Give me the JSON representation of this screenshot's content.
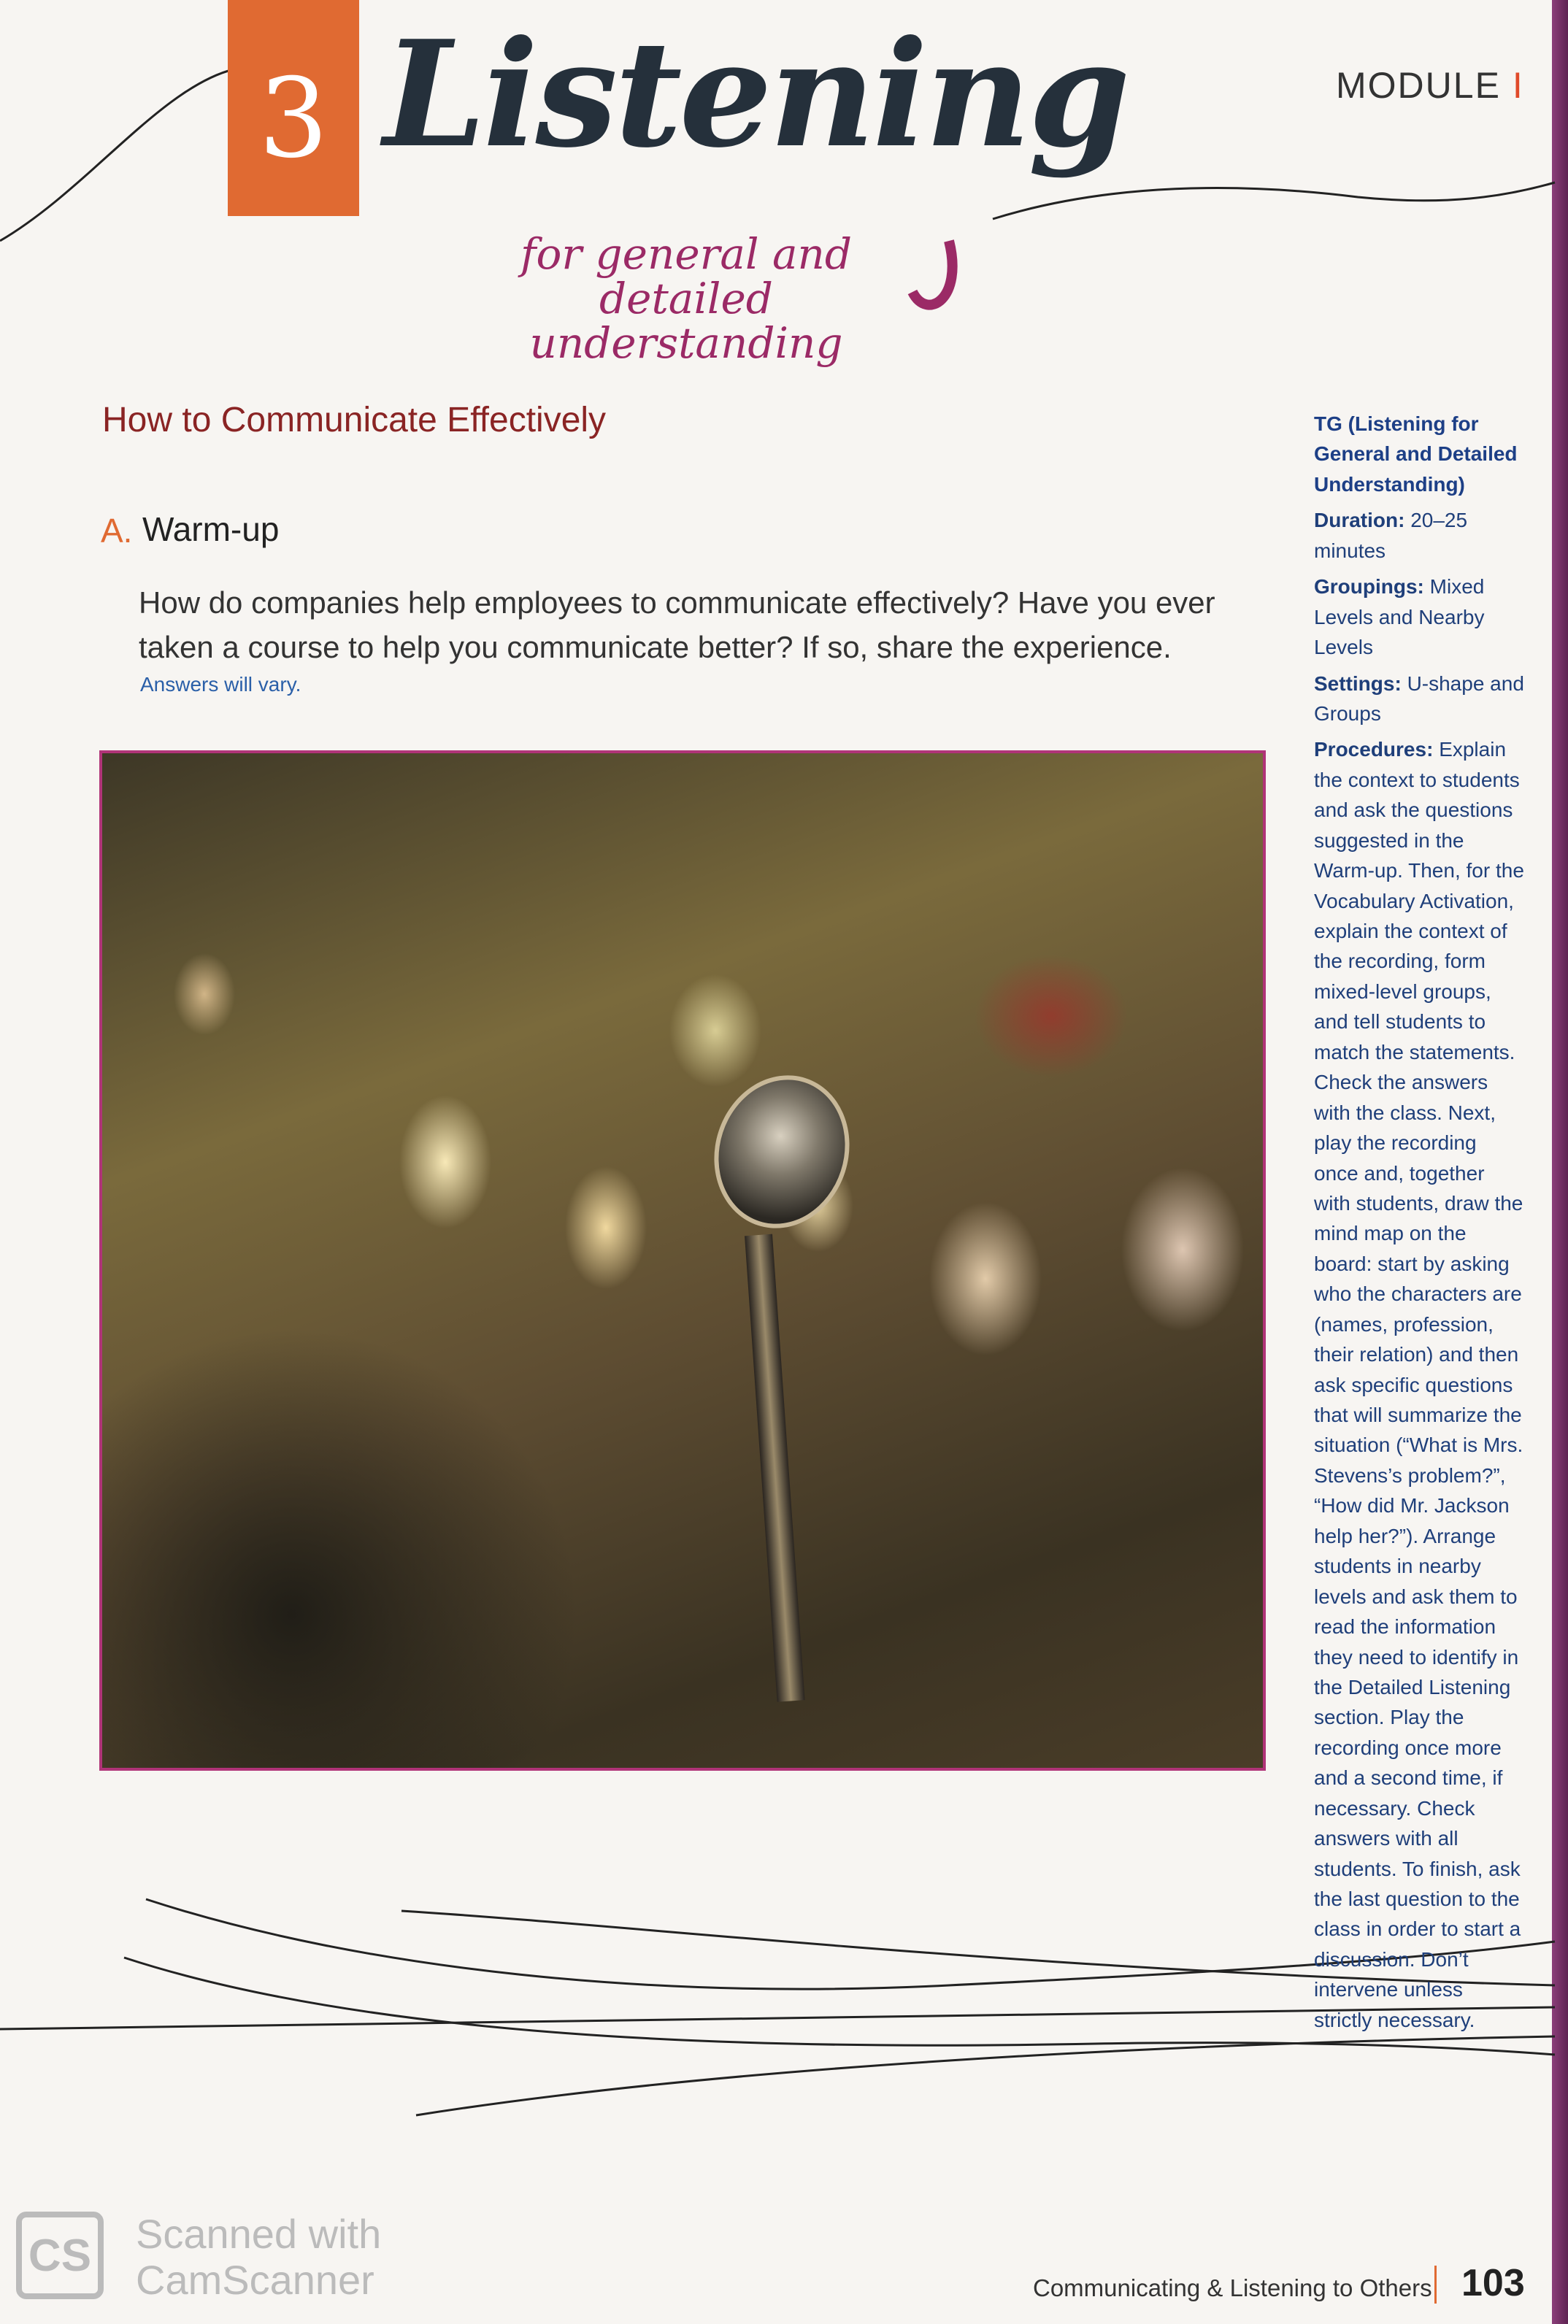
{
  "header": {
    "chapter_number": "3",
    "title": "Listening",
    "subtitle": "for general and detailed understanding",
    "module_label": "MODULE",
    "module_numeral": "I"
  },
  "section": {
    "heading": "How to Communicate Effectively",
    "warmup_letter": "A.",
    "warmup_title": "Warm-up",
    "question": "How do companies help employees to communicate effectively? Have you ever taken a course to help you communicate better? If so, share the experience.",
    "answer_note": "Answers will vary."
  },
  "photo": {
    "subject": "microphone-on-stand"
  },
  "sidebar": {
    "title": "TG (Listening for General and Detailed Understanding)",
    "duration_label": "Duration:",
    "duration_value": "20–25 minutes",
    "groupings_label": "Groupings:",
    "groupings_value": "Mixed Levels and Nearby Levels",
    "settings_label": "Settings:",
    "settings_value": "U-shape and Groups",
    "procedures_label": "Procedures:",
    "procedures_text": "Explain the context to students and ask the questions suggested in the Warm-up. Then, for the Vocabulary Activation, explain the context of the recording, form mixed-level groups, and tell students to match the statements. Check the answers with the class. Next, play the recording once and, together with students, draw the mind map on the board: start by asking who the characters are (names, profession, their relation) and then ask specific questions that will summarize the situation (“What is Mrs. Stevens’s problem?”, “How did Mr. Jackson help her?”). Arrange students in nearby levels and ask them to read the information they need to identify in the Detailed Listening section. Play the recording once more and a second time, if necessary. Check answers with all students. To finish, ask the last question to the class in order to start a discussion. Don’t intervene unless strictly necessary."
  },
  "footer": {
    "unit_title": "Communicating & Listening to Others",
    "page_number": "103"
  },
  "watermark": {
    "logo_text": "CS",
    "line1": "Scanned with",
    "line2": "CamScanner"
  },
  "colors": {
    "accent_orange": "#e06a32",
    "title_dark": "#25303b",
    "subtitle_plum": "#9b2a66",
    "heading_red": "#8a2424",
    "sidebar_blue": "#1f3f7a",
    "photo_border": "#b03478"
  }
}
